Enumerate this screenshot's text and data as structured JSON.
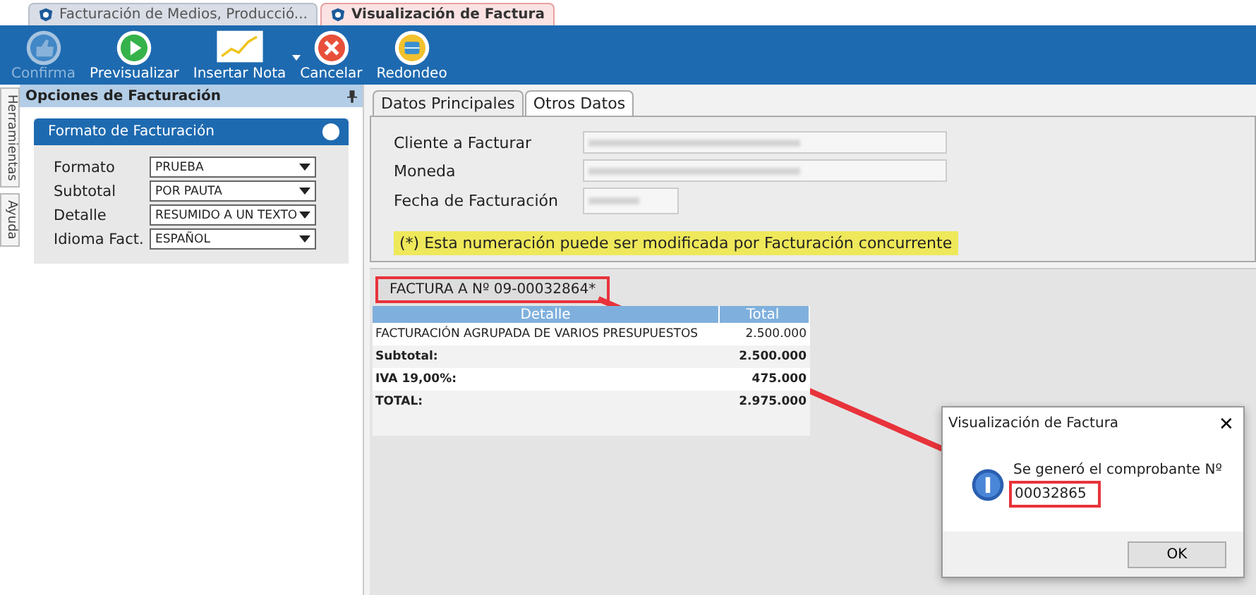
{
  "doc_tabs": [
    {
      "label": "Facturación de Medios, Producció...",
      "selected": false
    },
    {
      "label": "Visualización de Factura",
      "selected": true
    }
  ],
  "toolbar": [
    {
      "kind": "confirm",
      "label": "Confirma",
      "disabled": true
    },
    {
      "kind": "preview",
      "label": "Previsualizar",
      "disabled": false
    },
    {
      "kind": "note",
      "label": "Insertar Nota",
      "disabled": false
    },
    {
      "kind": "cancel",
      "label": "Cancelar",
      "disabled": false
    },
    {
      "kind": "round",
      "label": "Redondeo",
      "disabled": false
    }
  ],
  "side_tabs": [
    "Herramientas",
    "Ayuda"
  ],
  "panel": {
    "title": "Opciones de Facturación",
    "group": "Formato de Facturación",
    "fields": [
      {
        "label": "Formato",
        "value": "PRUEBA"
      },
      {
        "label": "Subtotal",
        "value": "POR PAUTA"
      },
      {
        "label": "Detalle",
        "value": "RESUMIDO A UN TEXTO"
      },
      {
        "label": "Idioma Fact.",
        "value": "ESPAÑOL"
      }
    ]
  },
  "main_tabs": [
    {
      "label": "Datos Principales",
      "selected": true
    },
    {
      "label": "Otros Datos",
      "selected": false
    }
  ],
  "main_fields": [
    {
      "label": "Cliente a Facturar",
      "kind": "wide"
    },
    {
      "label": "Moneda",
      "kind": "wide"
    },
    {
      "label": "Fecha de Facturación",
      "kind": "short"
    }
  ],
  "notice": "(*) Esta numeración puede ser modificada por Facturación concurrente",
  "invoice": {
    "heading": "FACTURA A Nº 09-00032864*",
    "columns": [
      "Detalle",
      "Total"
    ],
    "rows": [
      {
        "detail": "FACTURACIÓN AGRUPADA DE VARIOS PRESUPUESTOS",
        "total": "2.500.000",
        "bold": false
      },
      {
        "detail": "Subtotal:",
        "total": "2.500.000",
        "bold": true
      },
      {
        "detail": "IVA 19,00%:",
        "total": "475.000",
        "bold": true
      },
      {
        "detail": "TOTAL:",
        "total": "2.975.000",
        "bold": true
      }
    ]
  },
  "dialog": {
    "title": "Visualización de Factura",
    "close": "✕",
    "message": "Se generó el comprobante Nº",
    "number": "00032865",
    "button": "OK"
  }
}
